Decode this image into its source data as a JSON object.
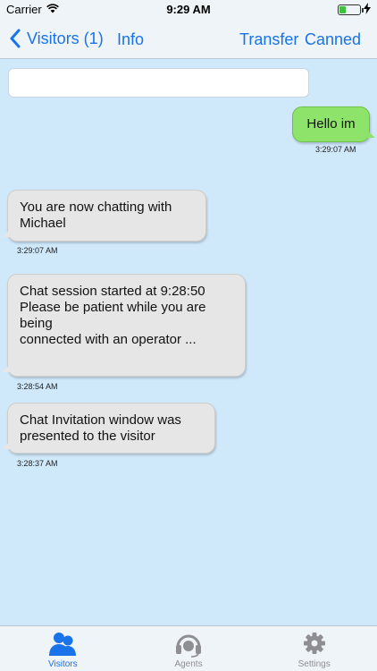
{
  "status_bar": {
    "carrier": "Carrier",
    "time": "9:29 AM"
  },
  "nav": {
    "back_label": "Visitors (1)",
    "info_label": "Info",
    "transfer_label": "Transfer",
    "canned_label": "Canned",
    "accent_color": "#1a73e8"
  },
  "message_input": {
    "value": "",
    "placeholder": ""
  },
  "messages": [
    {
      "direction": "out",
      "text": "Hello im",
      "time": "3:29:07 AM"
    },
    {
      "direction": "in",
      "lines": [
        "You are now chatting with",
        "Michael"
      ],
      "time": "3:29:07 AM"
    },
    {
      "direction": "in",
      "lines": [
        "Chat session started at 9:28:50",
        "Please be patient while you are being",
        "connected with an operator ..."
      ],
      "time": "3:28:54 AM"
    },
    {
      "direction": "in",
      "lines": [
        "Chat Invitation window was",
        "presented to the visitor"
      ],
      "time": "3:28:37 AM"
    }
  ],
  "tabs": [
    {
      "label": "Visitors",
      "icon": "visitors-icon",
      "active": true
    },
    {
      "label": "Agents",
      "icon": "headset-icon",
      "active": false
    },
    {
      "label": "Settings",
      "icon": "gear-icon",
      "active": false
    }
  ],
  "colors": {
    "background": "#cfe8fa",
    "outgoing_bubble": "#8ee36b",
    "incoming_bubble": "#e6e6e6",
    "tab_inactive": "#8e8e93"
  }
}
